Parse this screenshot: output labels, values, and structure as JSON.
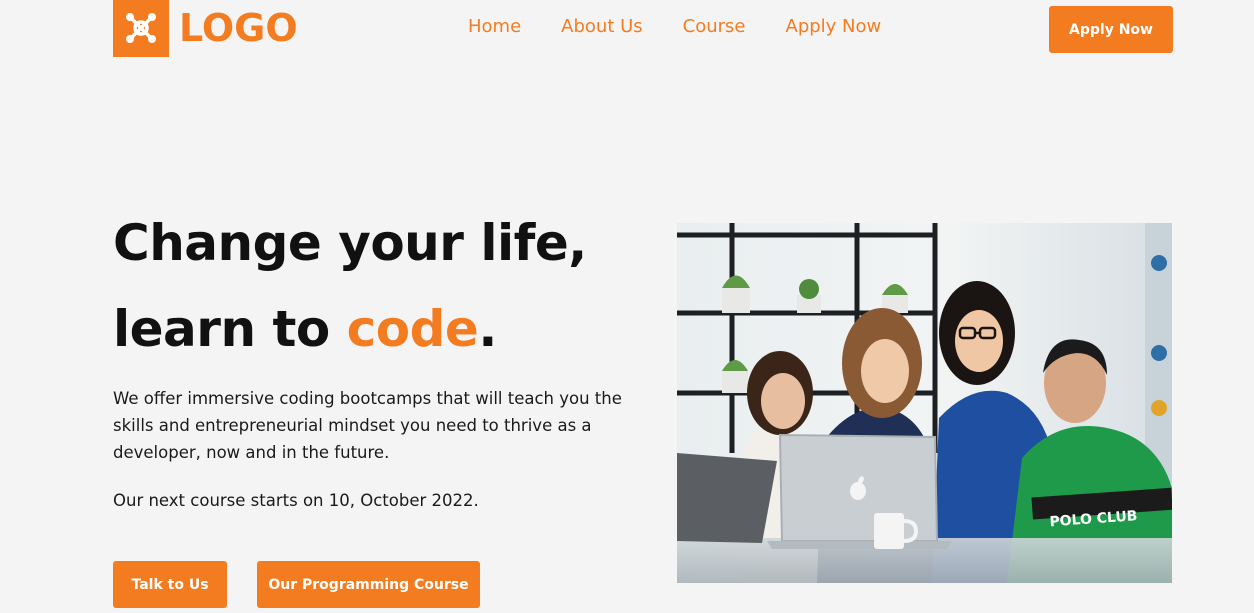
{
  "header": {
    "logo_text": "LOGO",
    "nav": [
      {
        "label": "Home"
      },
      {
        "label": "About Us"
      },
      {
        "label": "Course"
      },
      {
        "label": "Apply Now"
      }
    ],
    "cta_label": "Apply Now"
  },
  "hero": {
    "title_line1": "Change your life,",
    "title_line2_prefix": "learn to ",
    "title_line2_accent": "code",
    "title_line2_suffix": ".",
    "description": "We offer immersive coding bootcamps that will teach you the skills and entrepreneurial mindset you need to thrive as a developer, now and in the future.",
    "start_date": "Our next course starts on 10, October 2022.",
    "buttons": {
      "talk": "Talk to Us",
      "course": "Our Programming Course"
    }
  },
  "photo": {
    "shirt_text": "POLO CLUB"
  },
  "colors": {
    "accent": "#f47c20",
    "background": "#f4f4f4",
    "text": "#111111"
  },
  "icons": {
    "logo": "molecule-logo-icon",
    "laptop_logo": "apple-logo-icon"
  }
}
